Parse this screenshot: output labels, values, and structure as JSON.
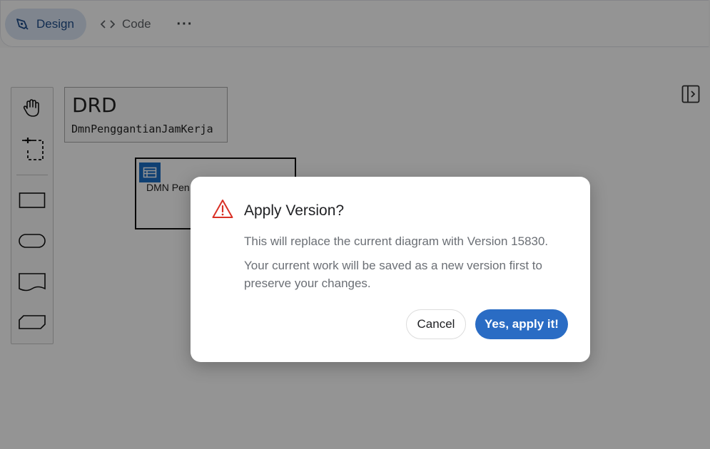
{
  "toolbar": {
    "tabs": [
      {
        "label": "Design",
        "icon": "pen-icon",
        "active": true
      },
      {
        "label": "Code",
        "icon": "code-icon",
        "active": false
      }
    ],
    "more_label": "···"
  },
  "palette": {
    "tools": [
      "hand-tool",
      "lasso-tool",
      "decision-shape",
      "input-data-shape",
      "knowledge-source-shape",
      "business-knowledge-shape"
    ]
  },
  "drd": {
    "title": "DRD",
    "name": "DmnPenggantianJamKerja"
  },
  "decision": {
    "label": "DMN Pen"
  },
  "dialog": {
    "title": "Apply Version?",
    "message1": "This will replace the current diagram with Version 15830.",
    "message2": "Your current work will be saved as a new version first to preserve your changes.",
    "cancel_label": "Cancel",
    "confirm_label": "Yes, apply it!"
  },
  "colors": {
    "accent": "#2a6cc4",
    "warning": "#d93025",
    "active_tab_bg": "#dbe5f4"
  }
}
